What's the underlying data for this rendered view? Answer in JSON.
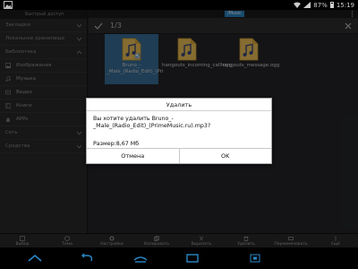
{
  "status_bar": {
    "battery_text": "87%",
    "time": "15:19"
  },
  "sidebar": {
    "header": "Быстрый доступ",
    "items": [
      {
        "label": "Закладки",
        "icon": "chevron-down-icon"
      },
      {
        "label": "Локальное хранилище",
        "icon": "chevron-down-icon"
      },
      {
        "label": "Библиотека",
        "icon": "chevron-down-icon"
      },
      {
        "label": "Изображения",
        "icon": "image-icon"
      },
      {
        "label": "Музыка",
        "icon": "music-icon"
      },
      {
        "label": "Видео",
        "icon": "video-icon"
      },
      {
        "label": "Книги",
        "icon": "book-icon"
      },
      {
        "label": "APPs",
        "icon": "android-icon"
      },
      {
        "label": "Сеть",
        "icon": "chevron-down-icon"
      },
      {
        "label": "Средства",
        "icon": "chevron-down-icon"
      }
    ]
  },
  "path": {
    "crumb": "/Music"
  },
  "toolbar": {
    "selected_count": "1/3"
  },
  "files": [
    {
      "name": "Bruno_-_Male_(Radio_Edit)_(Pri",
      "selected": true
    },
    {
      "name": "hangouts_incoming_call.ogg",
      "selected": false
    },
    {
      "name": "hangouts_message.ogg",
      "selected": false
    }
  ],
  "actions": [
    {
      "label": "Выбор",
      "icon": "select-icon"
    },
    {
      "label": "Темa",
      "icon": "theme-icon"
    },
    {
      "label": "Настройки",
      "icon": "gear-icon"
    },
    {
      "label": "Копировать",
      "icon": "copy-icon"
    },
    {
      "label": "Вырезать",
      "icon": "cut-icon"
    },
    {
      "label": "Удалить",
      "icon": "trash-icon"
    },
    {
      "label": "Переименовать",
      "icon": "rename-icon"
    },
    {
      "label": "Ещё",
      "icon": "more-icon"
    }
  ],
  "dialog": {
    "title": "Удалить",
    "message": "Вы хотите удалить Bruno_-_Male_(Radio_Edit)_(PrimeMusic.ru).mp3?",
    "size": "Размер:8,67 Мб",
    "cancel_label": "Отмена",
    "ok_label": "OK"
  },
  "colors": {
    "accent": "#2a88c6",
    "selection": "#3a6f9a",
    "dialog_bg": "#ffffff"
  }
}
